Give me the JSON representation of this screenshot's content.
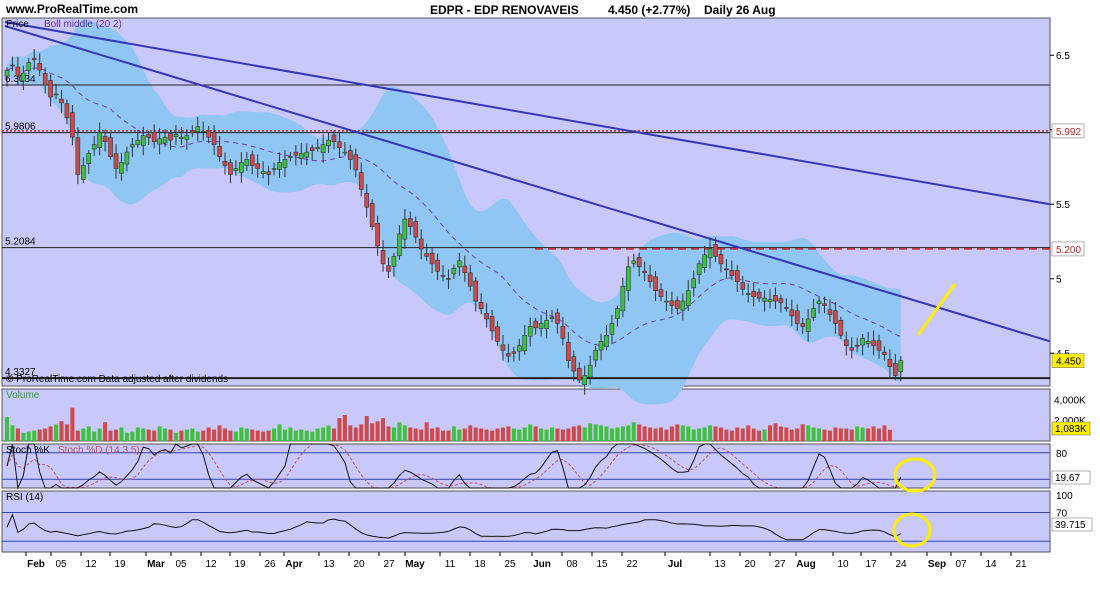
{
  "header": {
    "site": "www.ProRealTime.com",
    "title": "EDPR - EDP RENOVAVEIS",
    "price": "4.450 (+2.77%)",
    "period": "Daily",
    "date": "26 Aug"
  },
  "footer_note": "© ProRealTime.com  Data adjusted after dividends",
  "colors": {
    "panel_bg": "#c8c8fa",
    "bollinger_band": "#8fc6f4",
    "up_candle": "#3ec23e",
    "down_candle": "#d04848",
    "trendline": "#3636b8",
    "resistance": "#cc2222",
    "highlight": "#ffee00"
  },
  "chart_data": [
    {
      "type": "candlestick",
      "panel": "price",
      "label": "Price",
      "indicator_label": "Boll middle (20 2)",
      "ylim": [
        4.28,
        6.75
      ],
      "y_ticks": [
        6.5,
        6,
        5.5,
        5,
        4.5
      ],
      "y_tick_labels": [
        "6.5",
        "6",
        "5.5",
        "5",
        "4.5"
      ],
      "x_tick_labels": [
        "Feb",
        "05",
        "12",
        "19",
        "Mar",
        "05",
        "12",
        "19",
        "26",
        "Apr",
        "13",
        "20",
        "27",
        "May",
        "11",
        "18",
        "25",
        "Jun",
        "08",
        "15",
        "22",
        "Jul",
        "13",
        "20",
        "27",
        "Aug",
        "10",
        "17",
        "24",
        "Sep",
        "07",
        "14",
        "21"
      ],
      "x_tick_bold": [
        "Feb",
        "Mar",
        "Apr",
        "May",
        "Jun",
        "Jul",
        "Aug",
        "Sep"
      ],
      "h_levels": [
        {
          "value": 6.3,
          "label": "6.3034"
        },
        {
          "value": 5.9806,
          "label": "5.9806"
        },
        {
          "value": 5.2084,
          "label": "5.2084"
        },
        {
          "value": 4.3327,
          "label": "4.3327"
        }
      ],
      "price_tags": [
        "5.992",
        "5.200",
        "4.450"
      ],
      "close_series": [
        6.4,
        6.43,
        6.36,
        6.38,
        6.45,
        6.47,
        6.4,
        6.3,
        6.22,
        6.24,
        6.18,
        6.08,
        5.95,
        5.7,
        5.76,
        5.84,
        5.9,
        5.98,
        5.92,
        5.82,
        5.74,
        5.78,
        5.85,
        5.9,
        5.93,
        5.96,
        5.95,
        5.92,
        5.94,
        5.95,
        5.93,
        5.97,
        5.95,
        5.96,
        5.98,
        6.02,
        5.99,
        5.95,
        5.9,
        5.82,
        5.76,
        5.7,
        5.74,
        5.78,
        5.8,
        5.76,
        5.74,
        5.72,
        5.7,
        5.74,
        5.78,
        5.8,
        5.82,
        5.83,
        5.84,
        5.85,
        5.86,
        5.88,
        5.9,
        5.93,
        5.92,
        5.88,
        5.85,
        5.8,
        5.73,
        5.6,
        5.48,
        5.35,
        5.22,
        5.1,
        5.05,
        5.15,
        5.3,
        5.4,
        5.35,
        5.28,
        5.2,
        5.15,
        5.1,
        5.05,
        5.02,
        5.0,
        5.07,
        5.12,
        5.04,
        4.95,
        4.85,
        4.8,
        4.73,
        4.65,
        4.58,
        4.52,
        4.48,
        4.5,
        4.55,
        4.62,
        4.68,
        4.67,
        4.7,
        4.72,
        4.74,
        4.7,
        4.6,
        4.45,
        4.38,
        4.32,
        4.35,
        4.42,
        4.52,
        4.58,
        4.62,
        4.7,
        4.8,
        4.95,
        5.08,
        5.12,
        5.08,
        5.04,
        4.98,
        4.92,
        4.88,
        4.85,
        4.82,
        4.8,
        4.85,
        4.92,
        5.0,
        5.1,
        5.16,
        5.2,
        5.15,
        5.1,
        5.06,
        5.02,
        4.98,
        4.93,
        4.9,
        4.88,
        4.87,
        4.87,
        4.86,
        4.85,
        4.84,
        4.8,
        4.75,
        4.7,
        4.68,
        4.73,
        4.8,
        4.85,
        4.82,
        4.76,
        4.7,
        4.62,
        4.55,
        4.52,
        4.55,
        4.6,
        4.58,
        4.55,
        4.52,
        4.49,
        4.41,
        4.35,
        4.45
      ],
      "volume_ylim": [
        0,
        5000
      ],
      "volume_ticks": [
        "4,000K",
        "2,000K"
      ],
      "volume_tag": "1,083K",
      "volume_label": "Volume",
      "volume_series": [
        2300,
        1500,
        1200,
        800,
        900,
        1000,
        1100,
        1200,
        1400,
        1600,
        1900,
        1600,
        3200,
        1000,
        1200,
        1400,
        900,
        1200,
        1800,
        1000,
        1100,
        1300,
        800,
        900,
        1300,
        1200,
        1100,
        1000,
        1400,
        1200,
        1100,
        800,
        1000,
        1100,
        1200,
        900,
        1000,
        1300,
        1100,
        1500,
        1200,
        1000,
        900,
        1300,
        1200,
        1100,
        1000,
        900,
        1000,
        1200,
        1600,
        1100,
        1300,
        1000,
        1100,
        1000,
        900,
        1200,
        1300,
        1500,
        1200,
        2200,
        2500,
        1500,
        1300,
        1600,
        2400,
        1700,
        1900,
        2200,
        1400,
        1300,
        1800,
        1500,
        1300,
        1200,
        1100,
        1800,
        1200,
        1300,
        1000,
        1000,
        1400,
        1100,
        1200,
        1500,
        1300,
        1200,
        1100,
        1000,
        1200,
        1300,
        1400,
        1200,
        1100,
        1300,
        1600,
        1400,
        1200,
        1100,
        1300,
        1200,
        1100,
        1200,
        1400,
        1500,
        1300,
        1700,
        1600,
        1500,
        1400,
        1200,
        1300,
        1400,
        1500,
        1800,
        1600,
        1400,
        1300,
        1200,
        1300,
        1100,
        1400,
        1600,
        1500,
        1400,
        1100,
        1200,
        1300,
        1500,
        1400,
        1300,
        1100,
        1000,
        1300,
        1200,
        1500,
        1200,
        1000,
        1100,
        1500,
        1700,
        1400,
        1300,
        1100,
        1200,
        1600,
        1500,
        1300,
        1200,
        1100,
        1000,
        1300,
        1200,
        1200,
        1100,
        1400,
        1300,
        1200,
        1400,
        1200,
        1500,
        1083
      ]
    },
    {
      "type": "line",
      "panel": "stochastic",
      "label": "Stoch %K",
      "label2": "Stoch %D (14 3 5)",
      "ylim": [
        0,
        100
      ],
      "y_ticks": [
        80
      ],
      "y_tick_labels": [
        "80"
      ],
      "levels": [
        80,
        20
      ],
      "value_tag": "19.67"
    },
    {
      "type": "line",
      "panel": "rsi",
      "label": "RSI (14)",
      "ylim": [
        15,
        100
      ],
      "y_ticks": [
        100,
        70
      ],
      "y_tick_labels": [
        "100",
        "70"
      ],
      "levels": [
        70,
        30
      ],
      "value_tag": "39.715"
    }
  ]
}
